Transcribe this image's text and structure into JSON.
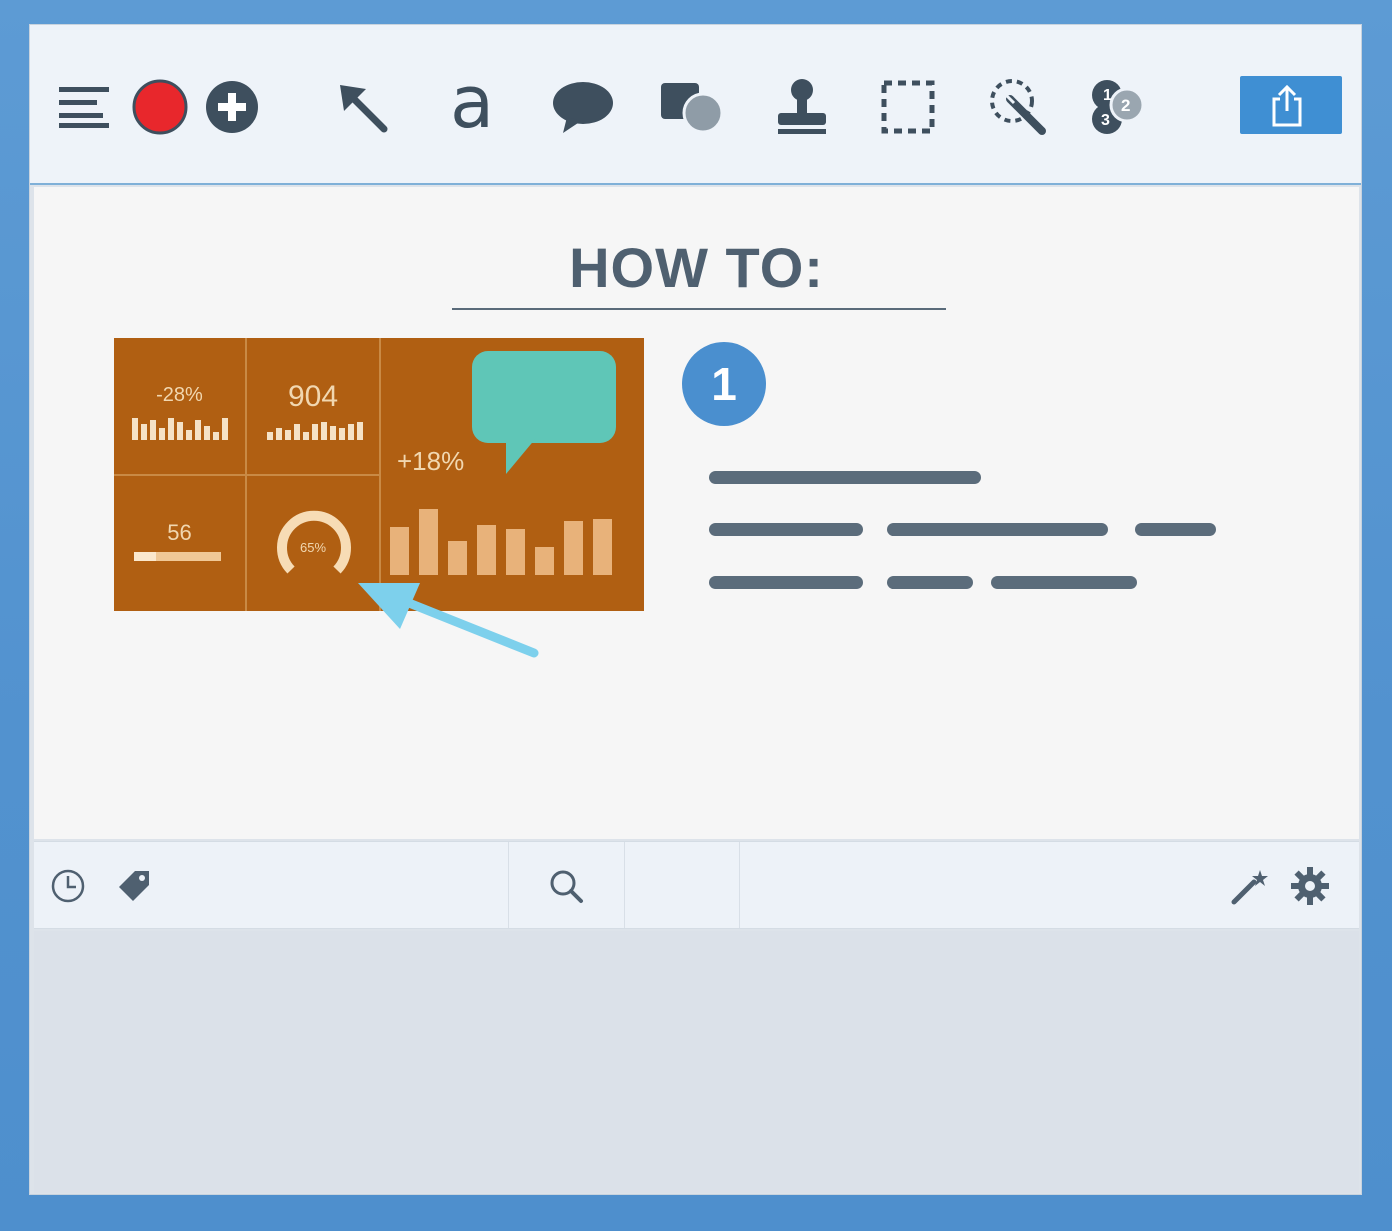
{
  "toolbar": {
    "tools": [
      "menu-icon",
      "record-icon",
      "add-icon",
      "arrow-icon",
      "text-icon",
      "callout-icon",
      "shape-icon",
      "stamp-icon",
      "selection-icon",
      "magic-wand-icon",
      "step-icon"
    ],
    "text_tool_glyph": "a",
    "step_tool_numbers": [
      "1",
      "2",
      "3"
    ],
    "record_color": "#e8272c",
    "share_button_color": "#3f8fd3"
  },
  "canvas": {
    "heading": "HOW TO:",
    "step_badge": "1",
    "dashboard": {
      "metric_1": "-28%",
      "metric_2": "904",
      "metric_3": "+18%",
      "metric_4": "56",
      "gauge_label": "65%",
      "gauge_value": 0.65,
      "progress_value": 0.25
    },
    "accent_colors": {
      "dashboard": "#b05f12",
      "callout": "#5fc6b7",
      "arrow": "#7dd0ec",
      "badge": "#4a8fcf"
    }
  },
  "statusbar": {
    "icons": [
      "clock-icon",
      "tag-icon",
      "search-icon",
      "magic-wand-icon",
      "gear-icon"
    ]
  }
}
